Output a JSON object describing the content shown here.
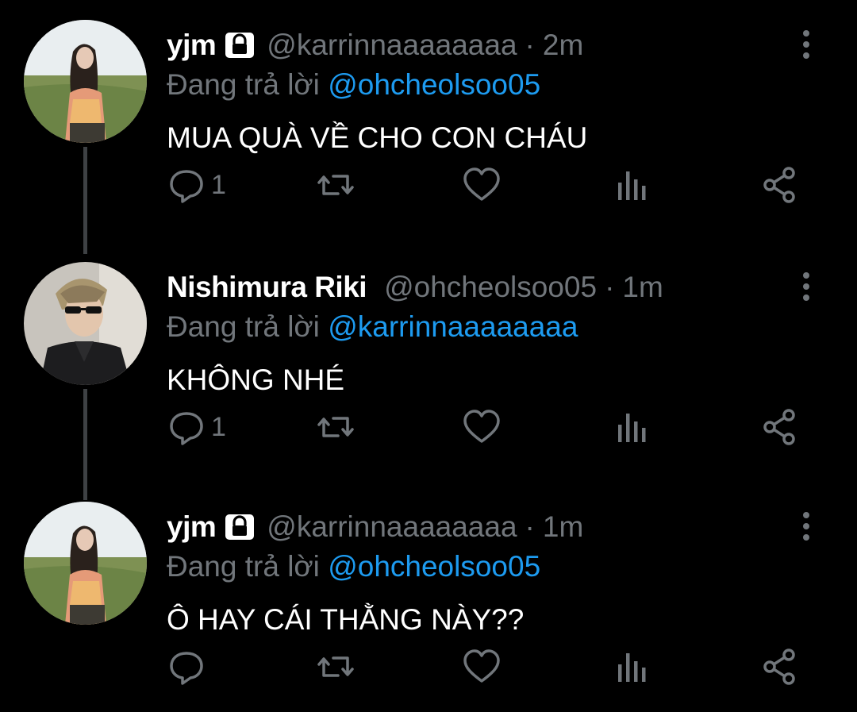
{
  "tweets": [
    {
      "name": "yjm",
      "locked": true,
      "handle": "@karrinnaaaaaaaa",
      "separator": "·",
      "time": "2m",
      "reply_prefix": "Đang trả lời",
      "reply_to": "@ohcheolsoo05",
      "text": "MUA QUÀ VỀ CHO CON CHÁU",
      "reply_count": "1",
      "avatar": "woman-in-field-avatar"
    },
    {
      "name": "Nishimura Riki",
      "locked": false,
      "handle": "@ohcheolsoo05",
      "separator": "·",
      "time": "1m",
      "reply_prefix": "Đang trả lời",
      "reply_to": "@karrinnaaaaaaaa",
      "text": "KHÔNG NHÉ",
      "reply_count": "1",
      "avatar": "man-with-sunglasses-avatar"
    },
    {
      "name": "yjm",
      "locked": true,
      "handle": "@karrinnaaaaaaaa",
      "separator": "·",
      "time": "1m",
      "reply_prefix": "Đang trả lời",
      "reply_to": "@ohcheolsoo05",
      "text": "Ô HAY CÁI THẰNG NÀY??",
      "reply_count": "",
      "avatar": "woman-in-field-avatar"
    }
  ],
  "icons": {
    "reply": "reply-icon",
    "retweet": "retweet-icon",
    "like": "heart-icon",
    "views": "analytics-icon",
    "share": "share-icon",
    "more": "more-options-icon",
    "lock": "lock-icon"
  },
  "colors": {
    "background": "#000000",
    "text": "#ffffff",
    "muted": "#71767b",
    "mention": "#1d9bf0",
    "thread_line": "#3e4144"
  }
}
